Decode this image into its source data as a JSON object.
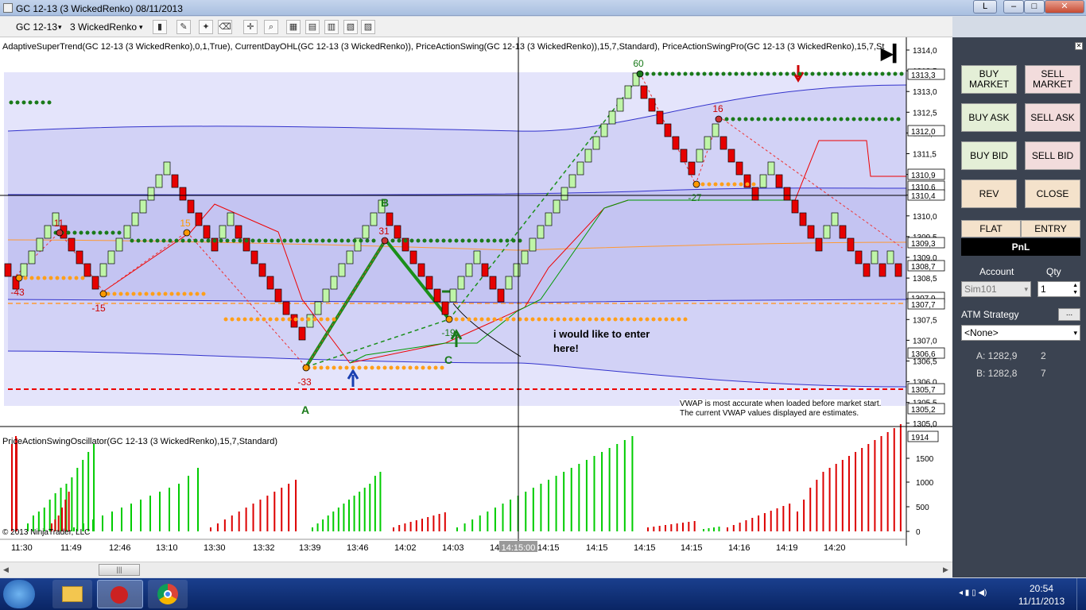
{
  "window": {
    "title": "GC 12-13 (3 WickedRenko)  08/11/2013",
    "button_L": "L",
    "minimize": "–",
    "maximize": "□",
    "close": "✕"
  },
  "toolbar": {
    "instrument": "GC 12-13",
    "period": "3 WickedRenko"
  },
  "chart": {
    "indicators_label": "AdaptiveSuperTrend(GC 12-13 (3 WickedRenko),0,1,True), CurrentDayOHL(GC 12-13 (3 WickedRenko)), PriceActionSwing(GC 12-13 (3 WickedRenko)),15,7,Standard), PriceActionSwingPro(GC 12-13 (3 WickedRenko),15,7,St",
    "oscillator_label": "PriceActionSwingOscillator(GC 12-13 (3 WickedRenko),15,7,Standard)",
    "copyright": "© 2013 NinjaTrader, LLC",
    "vwap_note_1": "VWAP is most accurate when loaded before market start.",
    "vwap_note_2": "The current VWAP values displayed are estimates.",
    "annotation": "i would like to enter",
    "annotation_2": "here!",
    "price_ticks": [
      "1314,0",
      "1313,5",
      "1313,0",
      "1312,5",
      "1312,0",
      "1311,5",
      "1311,0",
      "1310,5",
      "1310,0",
      "1309,5",
      "1309,0",
      "1308,5",
      "1308,0",
      "1307,5",
      "1307,0",
      "1306,5",
      "1306,0",
      "1305,5",
      "1305,0"
    ],
    "price_boxes": [
      "1313,3",
      "1312,0",
      "1310,9",
      "1310,6",
      "1310,4",
      "1309,3",
      "1308,7",
      "1307,9",
      "1307,7",
      "1306,6",
      "1305,7",
      "1305,2"
    ],
    "osc_ticks": [
      "1500",
      "1000",
      "500",
      "0"
    ],
    "osc_box": "1914",
    "time_ticks": [
      "11:30",
      "11:49",
      "12:46",
      "13:10",
      "13:30",
      "13:32",
      "13:39",
      "13:46",
      "14:02",
      "14:03",
      "14:08",
      "14:15:00",
      "14:15",
      "14:15",
      "14:15",
      "14:15",
      "14:16",
      "14:19",
      "14:20"
    ],
    "swing_labels": [
      "11",
      "15",
      "-43",
      "-15",
      "31",
      "-33",
      "-19",
      "60",
      "16",
      "-27",
      "B",
      "A",
      "C"
    ]
  },
  "panel": {
    "buy_market": "BUY MARKET",
    "sell_market": "SELL MARKET",
    "buy_ask": "BUY ASK",
    "sell_ask": "SELL ASK",
    "buy_bid": "BUY BID",
    "sell_bid": "SELL BID",
    "rev": "REV",
    "close": "CLOSE",
    "flat": "FLAT",
    "entry": "ENTRY",
    "pnl": "PnL",
    "account_label": "Account",
    "qty_label": "Qty",
    "account": "Sim101",
    "qty": "1",
    "atm_label": "ATM Strategy",
    "atm_btn": "...",
    "atm_value": "<None>",
    "a_label": "A: 1282,9",
    "a_value": "2",
    "b_label": "B: 1282,8",
    "b_value": "7"
  },
  "taskbar": {
    "time": "20:54",
    "date": "11/11/2013"
  }
}
